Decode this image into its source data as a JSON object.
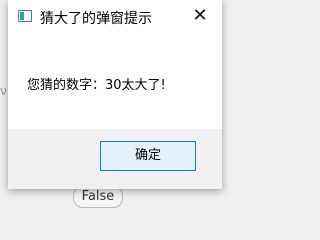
{
  "background": {
    "fragment_text": "ν",
    "false_button_label": "False"
  },
  "dialog": {
    "title": "猜大了的弹窗提示",
    "close_glyph": "✕",
    "message": "您猜的数字：30太大了!",
    "ok_label": "确定"
  },
  "colors": {
    "accent": "#0078d7",
    "button_bg": "#e5f1fb",
    "footer_bg": "#f0f0f0"
  }
}
